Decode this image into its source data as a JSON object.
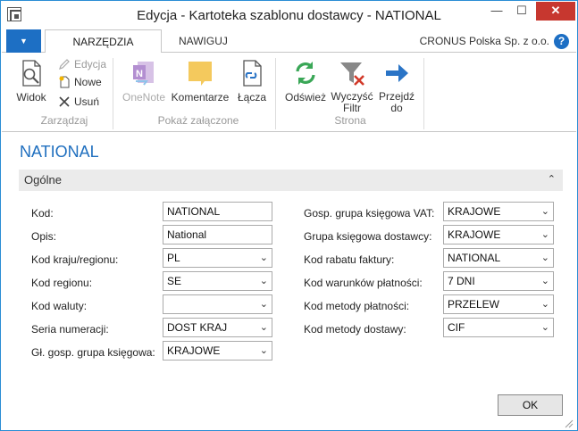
{
  "window": {
    "title": "Edycja - Kartoteka szablonu dostawcy - NATIONAL",
    "minimize": "—",
    "maximize": "☐",
    "close": "✕"
  },
  "tabs": {
    "file": "▼",
    "home": "NARZĘDZIA GŁÓWNE",
    "navigate": "NAWIGUJ",
    "company": "CRONUS Polska Sp. z o.o.",
    "help": "?"
  },
  "ribbon": {
    "view": "Widok",
    "edit": "Edycja",
    "new": "Nowe",
    "delete": "Usuń",
    "manage_group": "Zarządzaj",
    "onenote": "OneNote",
    "comments": "Komentarze",
    "links": "Łącza",
    "attachments_group": "Pokaż załączone",
    "refresh": "Odśwież",
    "clear_filter_1": "Wyczyść",
    "clear_filter_2": "Filtr",
    "goto_1": "Przejdź",
    "goto_2": "do",
    "page_group": "Strona"
  },
  "page": {
    "title": "NATIONAL",
    "fasttab": "Ogólne"
  },
  "fields_left": [
    {
      "label": "Kod:",
      "value": "NATIONAL",
      "type": "text"
    },
    {
      "label": "Opis:",
      "value": "National",
      "type": "text"
    },
    {
      "label": "Kod kraju/regionu:",
      "value": "PL",
      "type": "select"
    },
    {
      "label": "Kod regionu:",
      "value": "SE",
      "type": "select"
    },
    {
      "label": "Kod waluty:",
      "value": "",
      "type": "select"
    },
    {
      "label": "Seria numeracji:",
      "value": "DOST KRAJ",
      "type": "select"
    },
    {
      "label": "Gł. gosp. grupa księgowa:",
      "value": "KRAJOWE",
      "type": "select"
    }
  ],
  "fields_right": [
    {
      "label": "Gosp. grupa księgowa VAT:",
      "value": "KRAJOWE",
      "type": "select"
    },
    {
      "label": "Grupa księgowa dostawcy:",
      "value": "KRAJOWE",
      "type": "select"
    },
    {
      "label": "Kod rabatu faktury:",
      "value": "NATIONAL",
      "type": "select"
    },
    {
      "label": "Kod warunków płatności:",
      "value": "7 DNI",
      "type": "select"
    },
    {
      "label": "Kod metody płatności:",
      "value": "PRZELEW",
      "type": "select"
    },
    {
      "label": "Kod metody dostawy:",
      "value": "CIF",
      "type": "select"
    }
  ],
  "footer": {
    "ok": "OK"
  },
  "icons": {
    "chevron": "⌄",
    "collapse": "⌃"
  },
  "colors": {
    "accent": "#1d6fc4",
    "title": "#1f6fbf",
    "close": "#c7372f"
  }
}
